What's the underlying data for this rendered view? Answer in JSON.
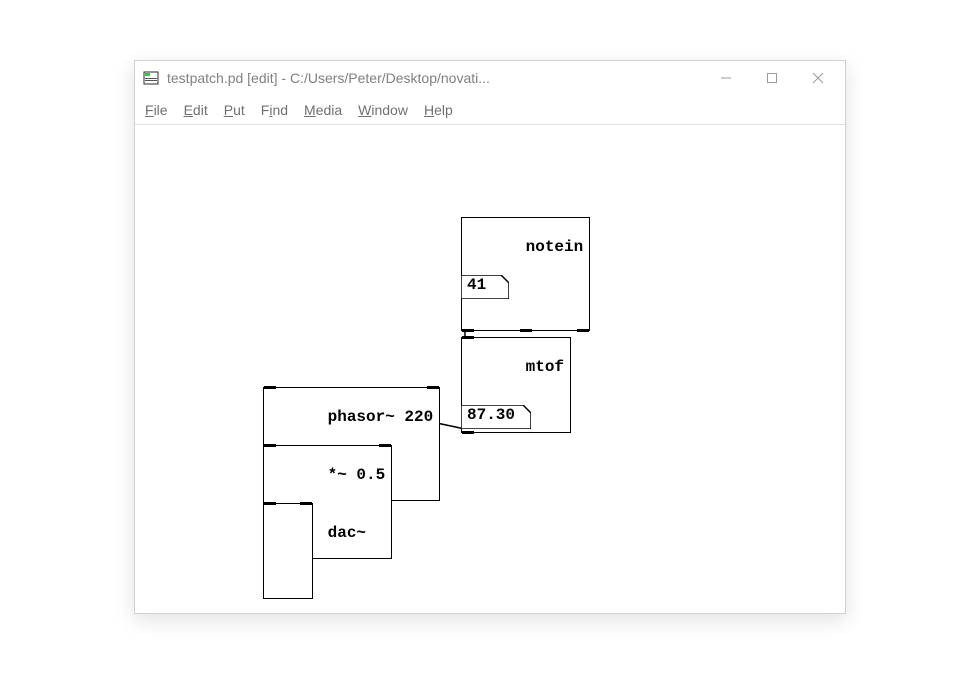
{
  "window": {
    "title": "testpatch.pd  [edit] - C:/Users/Peter/Desktop/novati..."
  },
  "menu": {
    "file": {
      "label": "File",
      "mnemonic": "F"
    },
    "edit": {
      "label": "Edit",
      "mnemonic": "E"
    },
    "put": {
      "label": "Put",
      "mnemonic": "P"
    },
    "find": {
      "label": "Find",
      "mnemonic": "i"
    },
    "media": {
      "label": "Media",
      "mnemonic": "M"
    },
    "window": {
      "label": "Window",
      "mnemonic": "W"
    },
    "help": {
      "label": "Help",
      "mnemonic": "H"
    }
  },
  "patch": {
    "notein": {
      "text": "notein"
    },
    "num1": {
      "value": "41"
    },
    "mtof": {
      "text": "mtof"
    },
    "num2": {
      "value": "87.30"
    },
    "phasor": {
      "text": "phasor~ 220"
    },
    "mult": {
      "text": "*~ 0.5"
    },
    "dac": {
      "text": "dac~"
    }
  }
}
